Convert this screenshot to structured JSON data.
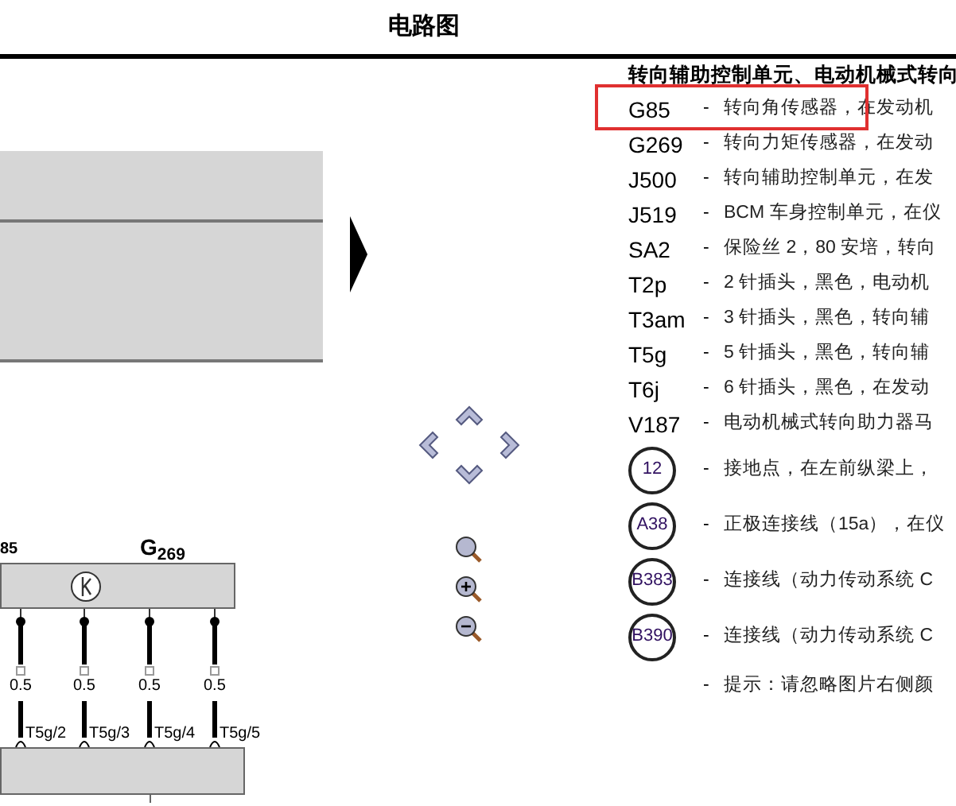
{
  "title": "电路图",
  "diagram": {
    "components": [
      {
        "label": "85",
        "cut": true
      },
      {
        "label": "G$_{269}$",
        "cut": false
      }
    ],
    "wires": [
      {
        "size": "0.5",
        "pin": "T5g/2"
      },
      {
        "size": "0.5",
        "pin": "T5g/3"
      },
      {
        "size": "0.5",
        "pin": "T5g/4"
      },
      {
        "size": "0.5",
        "pin": "T5g/5"
      }
    ]
  },
  "legend": {
    "heading": "转向辅助控制单元、电动机械式转向",
    "rows": [
      {
        "kind": "code",
        "code": "G85",
        "dash": "-",
        "text": "转向角传感器，在发动机",
        "highlighted": true
      },
      {
        "kind": "code",
        "code": "G269",
        "dash": "-",
        "text": "转向力矩传感器，在发动",
        "highlighted": false
      },
      {
        "kind": "code",
        "code": "J500",
        "dash": "-",
        "text": "转向辅助控制单元，在发",
        "highlighted": false
      },
      {
        "kind": "code",
        "code": "J519",
        "dash": "-",
        "text": "BCM 车身控制单元，在仪",
        "highlighted": false
      },
      {
        "kind": "code",
        "code": "SA2",
        "dash": "-",
        "text": "保险丝 2，80 安培，转向",
        "highlighted": false
      },
      {
        "kind": "code",
        "code": "T2p",
        "dash": "-",
        "text": "2 针插头，黑色，电动机",
        "highlighted": false
      },
      {
        "kind": "code",
        "code": "T3am",
        "dash": "-",
        "text": "3 针插头，黑色，转向辅",
        "highlighted": false
      },
      {
        "kind": "code",
        "code": "T5g",
        "dash": "-",
        "text": "5 针插头，黑色，转向辅",
        "highlighted": false
      },
      {
        "kind": "code",
        "code": "T6j",
        "dash": "-",
        "text": "6 针插头，黑色，在发动",
        "highlighted": false
      },
      {
        "kind": "code",
        "code": "V187",
        "dash": "-",
        "text": "电动机械式转向助力器马",
        "highlighted": false
      },
      {
        "kind": "circle",
        "code": "12",
        "dash": "-",
        "text": "接地点，在左前纵梁上，",
        "highlighted": false
      },
      {
        "kind": "circle",
        "code": "A38",
        "dash": "-",
        "text": "正极连接线（15a），在仪",
        "highlighted": false
      },
      {
        "kind": "circle",
        "code": "B383",
        "dash": "-",
        "text": "连接线（动力传动系统 C",
        "highlighted": false
      },
      {
        "kind": "circle",
        "code": "B390",
        "dash": "-",
        "text": "连接线（动力传动系统 C",
        "highlighted": false
      },
      {
        "kind": "note",
        "dash": "-",
        "text": "提示：请忽略图片右侧颜",
        "highlighted": false
      }
    ]
  }
}
